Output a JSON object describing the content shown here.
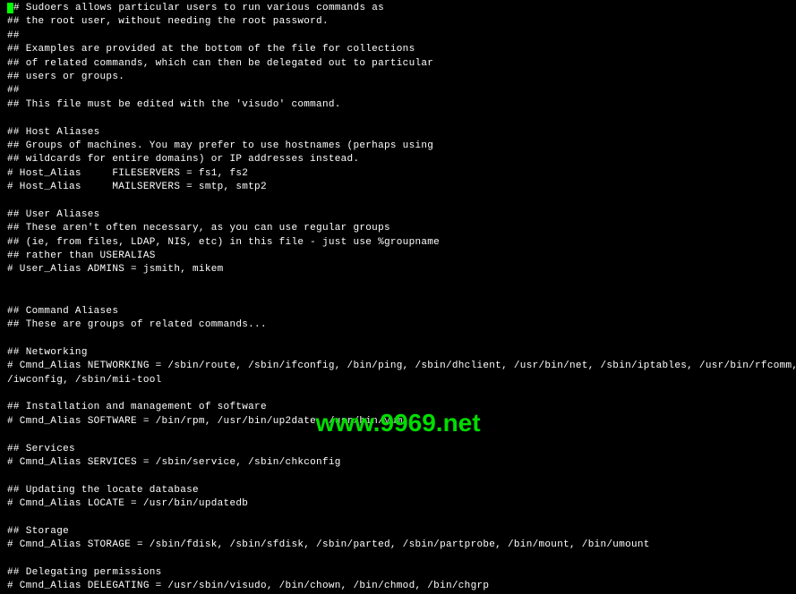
{
  "lines": [
    "## Sudoers allows particular users to run various commands as",
    "## the root user, without needing the root password.",
    "##",
    "## Examples are provided at the bottom of the file for collections",
    "## of related commands, which can then be delegated out to particular",
    "## users or groups.",
    "##",
    "## This file must be edited with the 'visudo' command.",
    "",
    "## Host Aliases",
    "## Groups of machines. You may prefer to use hostnames (perhaps using",
    "## wildcards for entire domains) or IP addresses instead.",
    "# Host_Alias     FILESERVERS = fs1, fs2",
    "# Host_Alias     MAILSERVERS = smtp, smtp2",
    "",
    "## User Aliases",
    "## These aren't often necessary, as you can use regular groups",
    "## (ie, from files, LDAP, NIS, etc) in this file - just use %groupname",
    "## rather than USERALIAS",
    "# User_Alias ADMINS = jsmith, mikem",
    "",
    "",
    "## Command Aliases",
    "## These are groups of related commands...",
    "",
    "## Networking",
    "# Cmnd_Alias NETWORKING = /sbin/route, /sbin/ifconfig, /bin/ping, /sbin/dhclient, /usr/bin/net, /sbin/iptables, /usr/bin/rfcomm, /usr/bin/wvdial, /sbin",
    "/iwconfig, /sbin/mii-tool",
    "",
    "## Installation and management of software",
    "# Cmnd_Alias SOFTWARE = /bin/rpm, /usr/bin/up2date, /usr/bin/yum",
    "",
    "## Services",
    "# Cmnd_Alias SERVICES = /sbin/service, /sbin/chkconfig",
    "",
    "## Updating the locate database",
    "# Cmnd_Alias LOCATE = /usr/bin/updatedb",
    "",
    "## Storage",
    "# Cmnd_Alias STORAGE = /sbin/fdisk, /sbin/sfdisk, /sbin/parted, /sbin/partprobe, /bin/mount, /bin/umount",
    "",
    "## Delegating permissions",
    "# Cmnd_Alias DELEGATING = /usr/sbin/visudo, /bin/chown, /bin/chmod, /bin/chgrp"
  ],
  "watermark": "www.9969.net"
}
